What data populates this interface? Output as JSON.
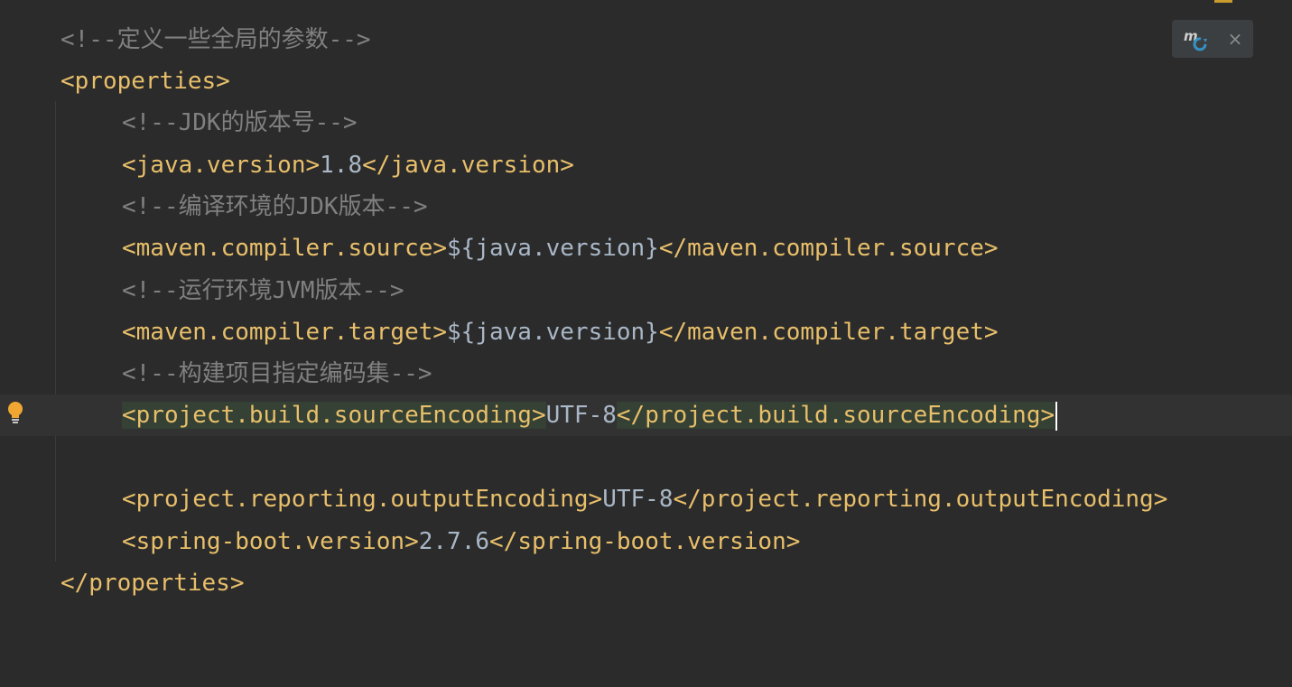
{
  "editor": {
    "lines": [
      {
        "comment": "<!--定义一些全局的参数-->"
      },
      {
        "open": "<properties>"
      },
      {
        "comment": "<!--JDK的版本号-->"
      },
      {
        "open": "<java.version>",
        "value": "1.8",
        "close": "</java.version>"
      },
      {
        "comment": "<!--编译环境的JDK版本-->"
      },
      {
        "open": "<maven.compiler.source>",
        "value": "${java.version}",
        "close": "</maven.compiler.source>"
      },
      {
        "comment": "<!--运行环境JVM版本-->"
      },
      {
        "open": "<maven.compiler.target>",
        "value": "${java.version}",
        "close": "</maven.compiler.target>"
      },
      {
        "comment": "<!--构建项目指定编码集-->"
      },
      {
        "open": "<project.build.sourceEncoding>",
        "value": "UTF-8",
        "close": "</project.build.sourceEncoding>"
      },
      {},
      {
        "open": "<project.reporting.outputEncoding>",
        "value": "UTF-8",
        "close": "</project.reporting.outputEncoding>"
      },
      {
        "open": "<spring-boot.version>",
        "value": "2.7.6",
        "close": "</spring-boot.version>"
      },
      {
        "close": "</properties>"
      }
    ],
    "current_line": 9
  },
  "maven_popup": {
    "icon": "maven-reload-icon",
    "close_glyph": "×"
  },
  "gutter": {
    "bulb_icon": "intention-bulb-icon"
  },
  "colors": {
    "background": "#2b2b2b",
    "tag": "#e8bf6a",
    "text": "#a9b7c6",
    "comment": "#808080",
    "highlight": "#344134"
  }
}
